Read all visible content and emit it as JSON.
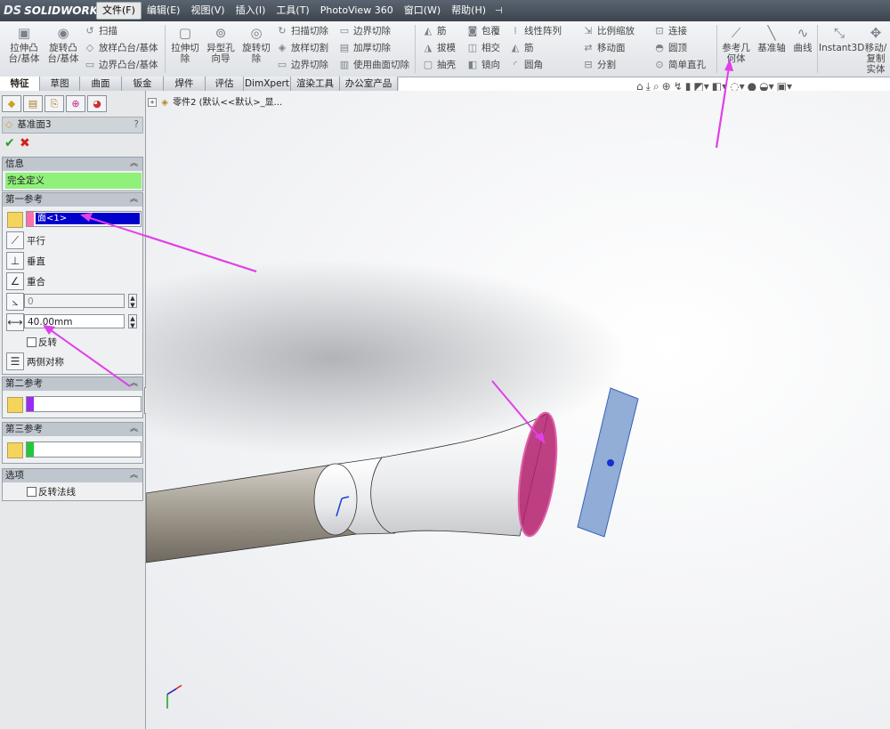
{
  "app": {
    "logo_mark": "DS",
    "logo_text": "SOLIDWORKS"
  },
  "menubar": {
    "items": [
      "文件(F)",
      "编辑(E)",
      "视图(V)",
      "插入(I)",
      "工具(T)",
      "PhotoView 360",
      "窗口(W)",
      "帮助(H)"
    ],
    "active_index": 0
  },
  "ribbon": {
    "extrude_boss": "拉伸凸台/基体",
    "revolve_boss": "旋转凸台/基体",
    "sweep": "扫描",
    "loft": "放样凸台/基体",
    "boundary_boss": "边界凸台/基体",
    "extrude_cut": "拉伸切除",
    "hole_wizard": "异型孔向导",
    "revolve_cut": "旋转切除",
    "swept_cut": "扫描切除",
    "lofted_cut": "放样切割",
    "boundary_cut": "边界切除",
    "boundary_cut2": "边界切除",
    "thicken_cut": "加厚切除",
    "surface_cut": "使用曲面切除",
    "rib": "筋",
    "draft": "拔模",
    "shell": "抽壳",
    "wrap": "包覆",
    "intersect": "相交",
    "mirror": "镜向",
    "linear_pattern": "线性阵列",
    "rib2": "筋",
    "fillet": "圆角",
    "scale": "比例缩放",
    "move_face": "移动面",
    "split": "分割",
    "connect": "连接",
    "dome": "圆顶",
    "simple_hole": "简单直孔",
    "ref_geometry": "参考几何体",
    "datum_axis": "基准轴",
    "curves": "曲线",
    "instant3d": "Instant3D",
    "move_copy": "移动/复制实体"
  },
  "command_tabs": [
    "特征",
    "草图",
    "曲面",
    "钣金",
    "焊件",
    "评估",
    "DimXpert",
    "渲染工具",
    "办公室产品"
  ],
  "feature_tree": {
    "root": "零件2 (默认<<默认>_显..."
  },
  "property_manager": {
    "title": "基准面3",
    "help": "?",
    "info": {
      "header": "信息",
      "message": "完全定义"
    },
    "first_reference": {
      "header": "第一参考",
      "selection": "面<1>",
      "color": "#ff6fa8",
      "options": [
        "平行",
        "垂直",
        "重合"
      ],
      "angle_value": "0",
      "distance_value": "40.00mm",
      "flip": "反转",
      "symmetric": "两侧对称"
    },
    "second_reference": {
      "header": "第二参考",
      "color": "#9b2bf0"
    },
    "third_reference": {
      "header": "第三参考",
      "color": "#22c83a"
    },
    "options": {
      "header": "选项",
      "flip_normal": "反转法线"
    }
  },
  "colors": {
    "accent_annotation": "#e040e8",
    "selected_face": "#d0307f",
    "preview_plane": "#7f9fcf",
    "info_ok": "#8ff07a"
  }
}
